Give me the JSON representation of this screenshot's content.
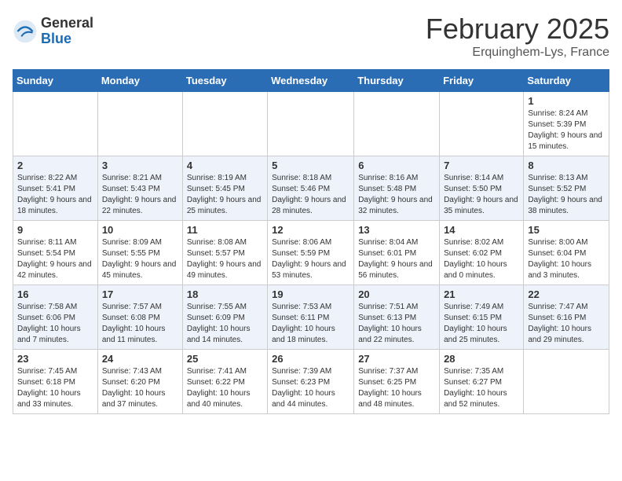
{
  "header": {
    "logo_general": "General",
    "logo_blue": "Blue",
    "month_title": "February 2025",
    "location": "Erquinghem-Lys, France"
  },
  "calendar": {
    "days_of_week": [
      "Sunday",
      "Monday",
      "Tuesday",
      "Wednesday",
      "Thursday",
      "Friday",
      "Saturday"
    ],
    "weeks": [
      [
        {
          "day": "",
          "info": ""
        },
        {
          "day": "",
          "info": ""
        },
        {
          "day": "",
          "info": ""
        },
        {
          "day": "",
          "info": ""
        },
        {
          "day": "",
          "info": ""
        },
        {
          "day": "",
          "info": ""
        },
        {
          "day": "1",
          "info": "Sunrise: 8:24 AM\nSunset: 5:39 PM\nDaylight: 9 hours and 15 minutes."
        }
      ],
      [
        {
          "day": "2",
          "info": "Sunrise: 8:22 AM\nSunset: 5:41 PM\nDaylight: 9 hours and 18 minutes."
        },
        {
          "day": "3",
          "info": "Sunrise: 8:21 AM\nSunset: 5:43 PM\nDaylight: 9 hours and 22 minutes."
        },
        {
          "day": "4",
          "info": "Sunrise: 8:19 AM\nSunset: 5:45 PM\nDaylight: 9 hours and 25 minutes."
        },
        {
          "day": "5",
          "info": "Sunrise: 8:18 AM\nSunset: 5:46 PM\nDaylight: 9 hours and 28 minutes."
        },
        {
          "day": "6",
          "info": "Sunrise: 8:16 AM\nSunset: 5:48 PM\nDaylight: 9 hours and 32 minutes."
        },
        {
          "day": "7",
          "info": "Sunrise: 8:14 AM\nSunset: 5:50 PM\nDaylight: 9 hours and 35 minutes."
        },
        {
          "day": "8",
          "info": "Sunrise: 8:13 AM\nSunset: 5:52 PM\nDaylight: 9 hours and 38 minutes."
        }
      ],
      [
        {
          "day": "9",
          "info": "Sunrise: 8:11 AM\nSunset: 5:54 PM\nDaylight: 9 hours and 42 minutes."
        },
        {
          "day": "10",
          "info": "Sunrise: 8:09 AM\nSunset: 5:55 PM\nDaylight: 9 hours and 45 minutes."
        },
        {
          "day": "11",
          "info": "Sunrise: 8:08 AM\nSunset: 5:57 PM\nDaylight: 9 hours and 49 minutes."
        },
        {
          "day": "12",
          "info": "Sunrise: 8:06 AM\nSunset: 5:59 PM\nDaylight: 9 hours and 53 minutes."
        },
        {
          "day": "13",
          "info": "Sunrise: 8:04 AM\nSunset: 6:01 PM\nDaylight: 9 hours and 56 minutes."
        },
        {
          "day": "14",
          "info": "Sunrise: 8:02 AM\nSunset: 6:02 PM\nDaylight: 10 hours and 0 minutes."
        },
        {
          "day": "15",
          "info": "Sunrise: 8:00 AM\nSunset: 6:04 PM\nDaylight: 10 hours and 3 minutes."
        }
      ],
      [
        {
          "day": "16",
          "info": "Sunrise: 7:58 AM\nSunset: 6:06 PM\nDaylight: 10 hours and 7 minutes."
        },
        {
          "day": "17",
          "info": "Sunrise: 7:57 AM\nSunset: 6:08 PM\nDaylight: 10 hours and 11 minutes."
        },
        {
          "day": "18",
          "info": "Sunrise: 7:55 AM\nSunset: 6:09 PM\nDaylight: 10 hours and 14 minutes."
        },
        {
          "day": "19",
          "info": "Sunrise: 7:53 AM\nSunset: 6:11 PM\nDaylight: 10 hours and 18 minutes."
        },
        {
          "day": "20",
          "info": "Sunrise: 7:51 AM\nSunset: 6:13 PM\nDaylight: 10 hours and 22 minutes."
        },
        {
          "day": "21",
          "info": "Sunrise: 7:49 AM\nSunset: 6:15 PM\nDaylight: 10 hours and 25 minutes."
        },
        {
          "day": "22",
          "info": "Sunrise: 7:47 AM\nSunset: 6:16 PM\nDaylight: 10 hours and 29 minutes."
        }
      ],
      [
        {
          "day": "23",
          "info": "Sunrise: 7:45 AM\nSunset: 6:18 PM\nDaylight: 10 hours and 33 minutes."
        },
        {
          "day": "24",
          "info": "Sunrise: 7:43 AM\nSunset: 6:20 PM\nDaylight: 10 hours and 37 minutes."
        },
        {
          "day": "25",
          "info": "Sunrise: 7:41 AM\nSunset: 6:22 PM\nDaylight: 10 hours and 40 minutes."
        },
        {
          "day": "26",
          "info": "Sunrise: 7:39 AM\nSunset: 6:23 PM\nDaylight: 10 hours and 44 minutes."
        },
        {
          "day": "27",
          "info": "Sunrise: 7:37 AM\nSunset: 6:25 PM\nDaylight: 10 hours and 48 minutes."
        },
        {
          "day": "28",
          "info": "Sunrise: 7:35 AM\nSunset: 6:27 PM\nDaylight: 10 hours and 52 minutes."
        },
        {
          "day": "",
          "info": ""
        }
      ]
    ]
  }
}
